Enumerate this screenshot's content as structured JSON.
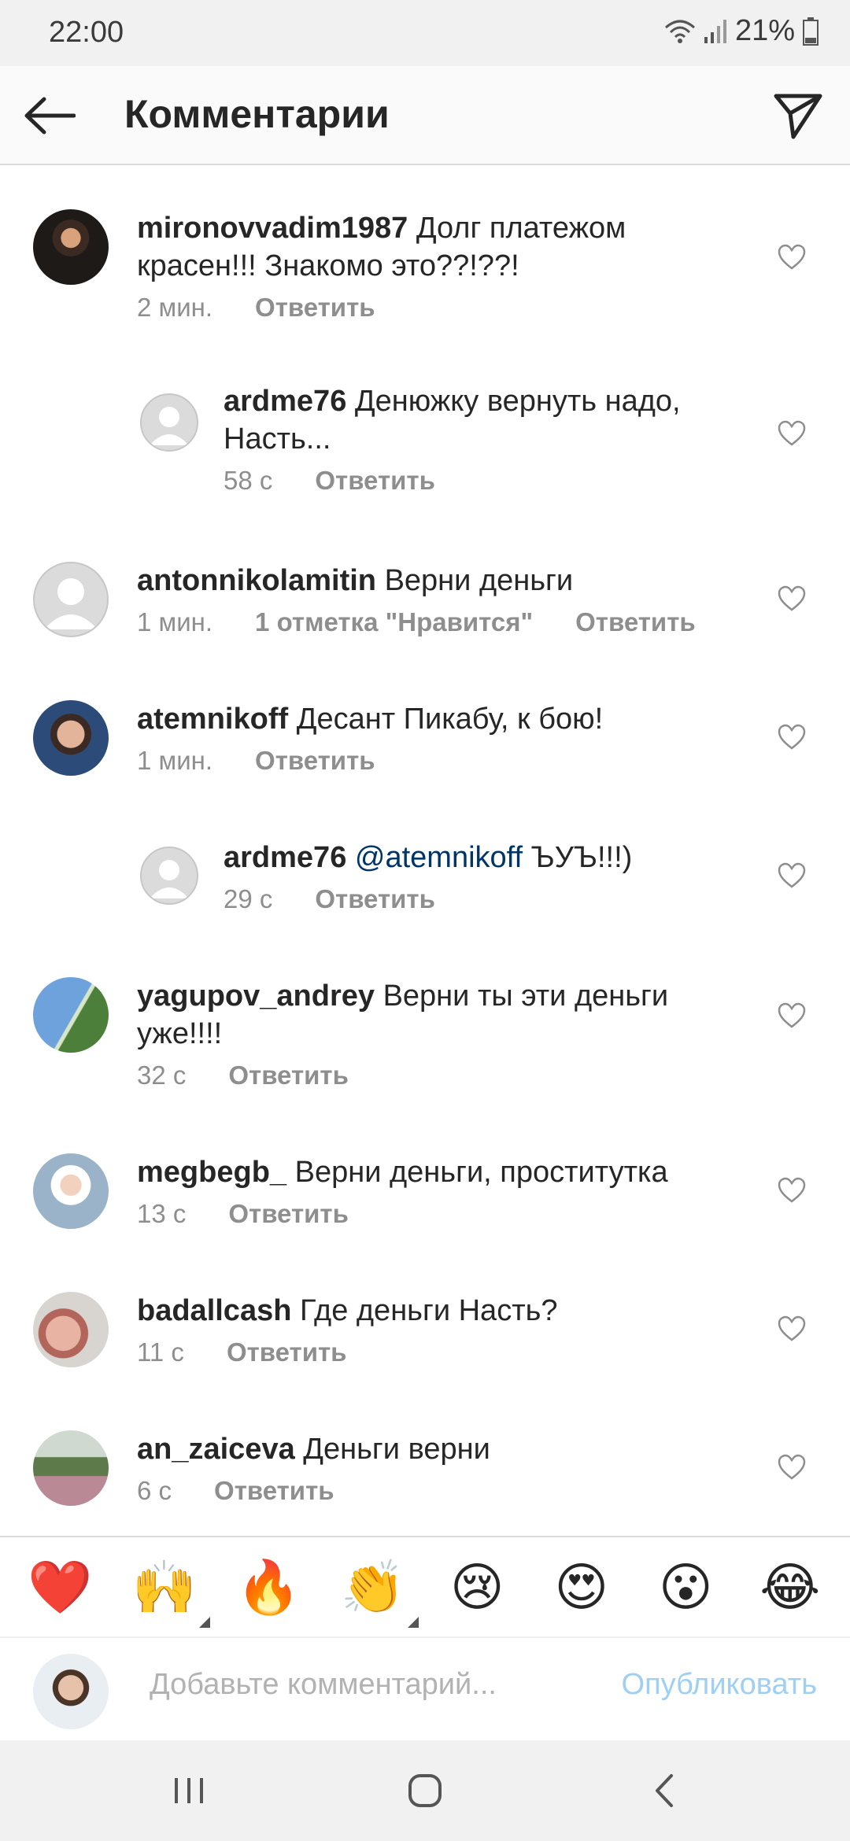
{
  "status": {
    "time": "22:00",
    "battery": "21%",
    "icons": [
      "wifi-icon",
      "signal-icon",
      "battery-icon"
    ]
  },
  "header": {
    "title": "Комментарии",
    "back_icon": "arrow-left-icon",
    "send_icon": "paper-plane-icon"
  },
  "comments": [
    {
      "user": "mironovvadim1987",
      "text": "Долг платежом красен!!! Знакомо это??!??!",
      "mention": "",
      "time": "2 мин.",
      "likes": "",
      "reply": "Ответить"
    },
    {
      "user": "ardme76",
      "text": "Денюжку вернуть надо, Насть...",
      "mention": "",
      "time": "58 с",
      "likes": "",
      "reply": "Ответить"
    },
    {
      "user": "antonnikolamitin",
      "text": "Верни деньги",
      "mention": "",
      "time": "1 мин.",
      "likes": "1 отметка \"Нравится\"",
      "reply": "Ответить"
    },
    {
      "user": "atemnikoff",
      "text": "Десант Пикабу, к бою!",
      "mention": "",
      "time": "1 мин.",
      "likes": "",
      "reply": "Ответить"
    },
    {
      "user": "ardme76",
      "text": "ЪУЪ!!!)",
      "mention": "@atemnikoff",
      "time": "29 с",
      "likes": "",
      "reply": "Ответить"
    },
    {
      "user": "yagupov_andrey",
      "text": "Верни ты эти деньги уже!!!!",
      "mention": "",
      "time": "32 с",
      "likes": "",
      "reply": "Ответить"
    },
    {
      "user": "megbegb_",
      "text": "Верни деньги, проститутка",
      "mention": "",
      "time": "13 с",
      "likes": "",
      "reply": "Ответить"
    },
    {
      "user": "badallcash",
      "text": "Где деньги Насть?",
      "mention": "",
      "time": "11 с",
      "likes": "",
      "reply": "Ответить"
    },
    {
      "user": "an_zaiceva",
      "text": "Деньги верни",
      "mention": "",
      "time": "6 с",
      "likes": "",
      "reply": "Ответить"
    }
  ],
  "emoji_bar": [
    "❤️",
    "🙌",
    "🔥",
    "👏",
    "😢",
    "😍",
    "😮",
    "😂"
  ],
  "composer": {
    "placeholder": "Добавьте комментарий...",
    "post_label": "Опубликовать"
  },
  "colors": {
    "text": "#262626",
    "meta": "#8e8e8e",
    "mention": "#003569",
    "post_disabled": "#9fd0f3",
    "divider": "#dbdbdb"
  }
}
